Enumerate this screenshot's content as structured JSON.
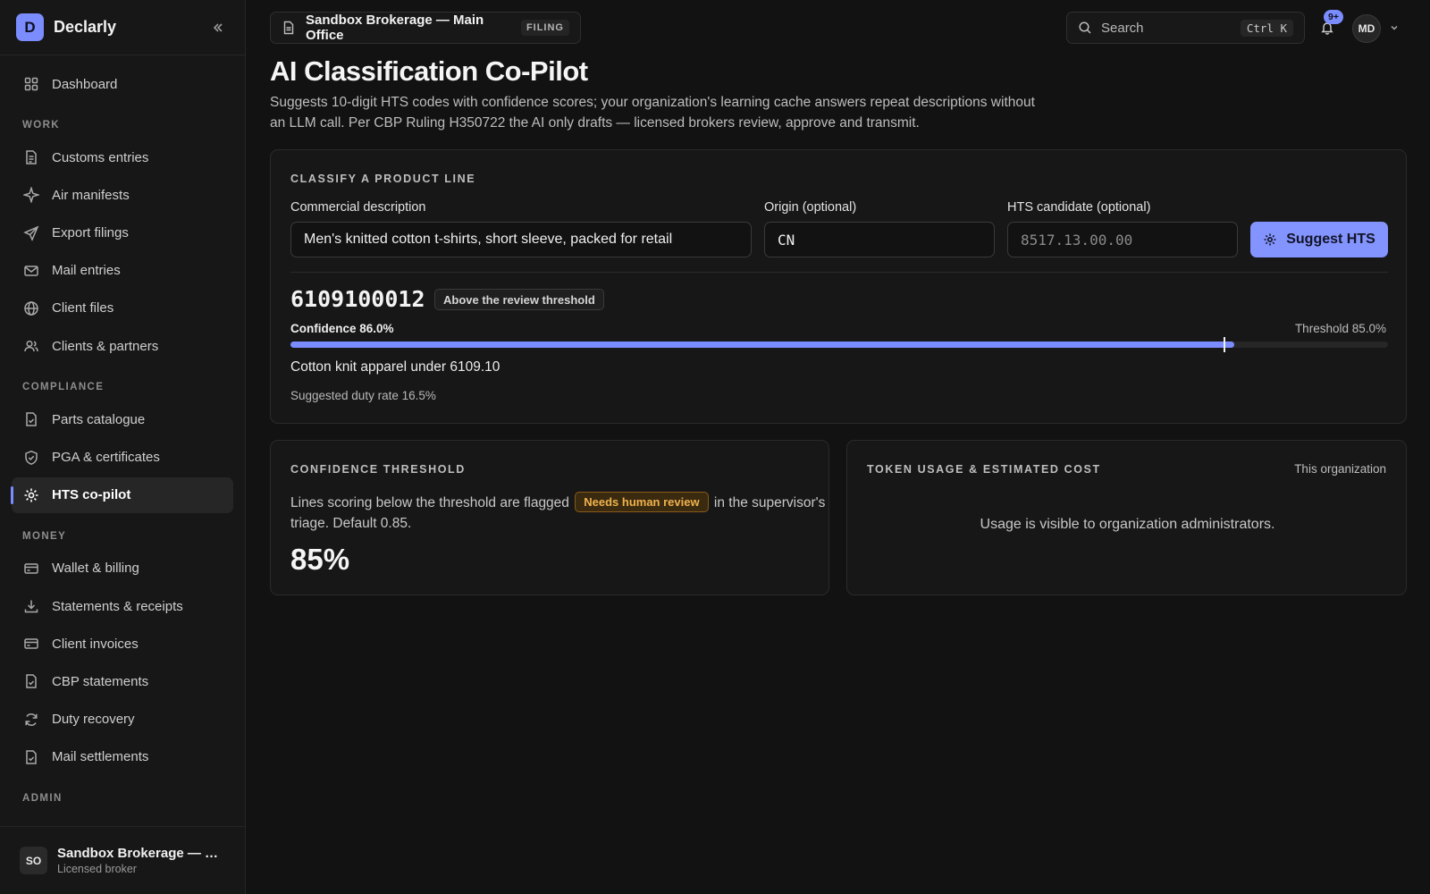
{
  "app": {
    "logo_letter": "D",
    "name": "Declarly"
  },
  "sidebar": {
    "top_item": {
      "label": "Dashboard",
      "icon": "grid-icon"
    },
    "sections": [
      {
        "label": "WORK",
        "items": [
          {
            "label": "Customs entries",
            "icon": "document-icon"
          },
          {
            "label": "Air manifests",
            "icon": "sparkle-icon"
          },
          {
            "label": "Export filings",
            "icon": "send-icon"
          },
          {
            "label": "Mail entries",
            "icon": "mail-icon"
          },
          {
            "label": "Client files",
            "icon": "globe-icon"
          },
          {
            "label": "Clients & partners",
            "icon": "users-icon"
          }
        ]
      },
      {
        "label": "COMPLIANCE",
        "items": [
          {
            "label": "Parts catalogue",
            "icon": "file-check-icon"
          },
          {
            "label": "PGA & certificates",
            "icon": "shield-icon"
          },
          {
            "label": "HTS co-pilot",
            "icon": "sun-icon",
            "active": true
          }
        ]
      },
      {
        "label": "MONEY",
        "items": [
          {
            "label": "Wallet & billing",
            "icon": "card-icon"
          },
          {
            "label": "Statements & receipts",
            "icon": "download-icon"
          },
          {
            "label": "Client invoices",
            "icon": "card-icon"
          },
          {
            "label": "CBP statements",
            "icon": "file-check-icon"
          },
          {
            "label": "Duty recovery",
            "icon": "refresh-icon"
          },
          {
            "label": "Mail settlements",
            "icon": "file-check-icon"
          }
        ]
      },
      {
        "label": "ADMIN",
        "items": []
      }
    ],
    "user": {
      "initials": "SO",
      "name": "Sandbox Brokerage — Main Office",
      "role": "Licensed broker"
    }
  },
  "topbar": {
    "office_name": "Sandbox Brokerage — Main Office",
    "office_tag": "FILING",
    "search_label": "Search",
    "search_shortcut": "Ctrl K",
    "notification_count": "9+",
    "user_initials": "MD"
  },
  "page": {
    "title": "AI Classification Co-Pilot",
    "description": "Suggests 10-digit HTS codes with confidence scores; your organization's learning cache answers repeat descriptions without an LLM call. Per CBP Ruling H350722 the AI only drafts — licensed brokers review, approve and transmit."
  },
  "classify": {
    "title": "CLASSIFY A PRODUCT LINE",
    "description_label": "Commercial description",
    "description_value": "Men's knitted cotton t-shirts, short sleeve, packed for retail",
    "origin_label": "Origin (optional)",
    "origin_value": "CN",
    "hts_label": "HTS candidate (optional)",
    "hts_placeholder": "8517.13.00.00",
    "suggest_button": "Suggest HTS",
    "result": {
      "code": "6109100012",
      "status": "Above the review threshold",
      "confidence_label": "Confidence 86.0%",
      "confidence": 0.86,
      "threshold_label": "Threshold 85.0%",
      "threshold": 0.85,
      "explanation": "Cotton knit apparel under 6109.10",
      "duty_rate": "Suggested duty rate 16.5%"
    }
  },
  "threshold_card": {
    "title": "CONFIDENCE THRESHOLD",
    "text_before": "Lines scoring below the threshold are flagged",
    "flag_label": "Needs human review",
    "text_after": "in the supervisor's triage. Default 0.85.",
    "value": "85%"
  },
  "usage_card": {
    "title": "TOKEN USAGE & ESTIMATED COST",
    "scope": "This organization",
    "message": "Usage is visible to organization administrators."
  },
  "colors": {
    "accent": "#7b8cff",
    "warning": "#f0b24c",
    "background": "#121212"
  }
}
